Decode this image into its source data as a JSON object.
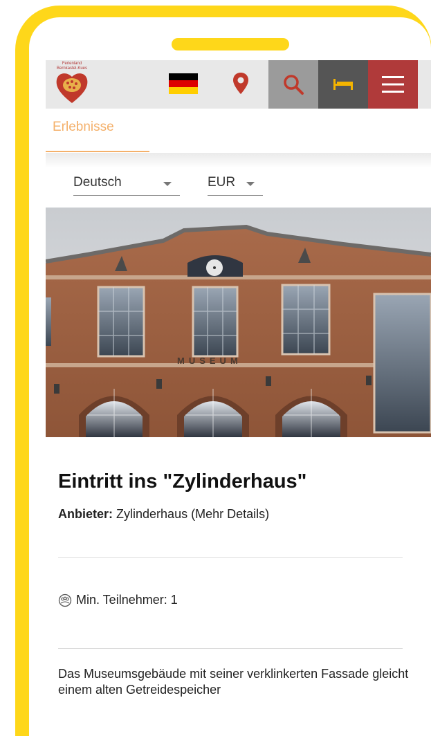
{
  "header": {
    "logo_text": "Ferienland Bernkastel-Kues",
    "flag_icon": "germany-flag-icon",
    "location_icon": "map-pin-icon",
    "search_icon": "search-icon",
    "accommodation_icon": "bed-icon",
    "menu_icon": "hamburger-menu-icon"
  },
  "tab": {
    "label": "Erlebnisse"
  },
  "language_select": {
    "value": "Deutsch"
  },
  "currency_select": {
    "value": "EUR"
  },
  "photo_sign": "MUSEUM",
  "offer": {
    "title": "Eintritt ins \"Zylinderhaus\"",
    "provider_label": "Anbieter:",
    "provider_value": "Zylinderhaus (Mehr Details)",
    "participants": "Min. Teilnehmer: 1",
    "description": "Das Museumsgebäude mit seiner verklinkerten Fassade gleicht einem alten Getreidespeicher"
  },
  "colors": {
    "frame": "#fed71a",
    "accent_orange": "#f4b06a",
    "menu_red": "#b03a3a",
    "search_gray": "#9b9b9b",
    "bed_dark": "#555555",
    "pin_red": "#c0392b"
  }
}
